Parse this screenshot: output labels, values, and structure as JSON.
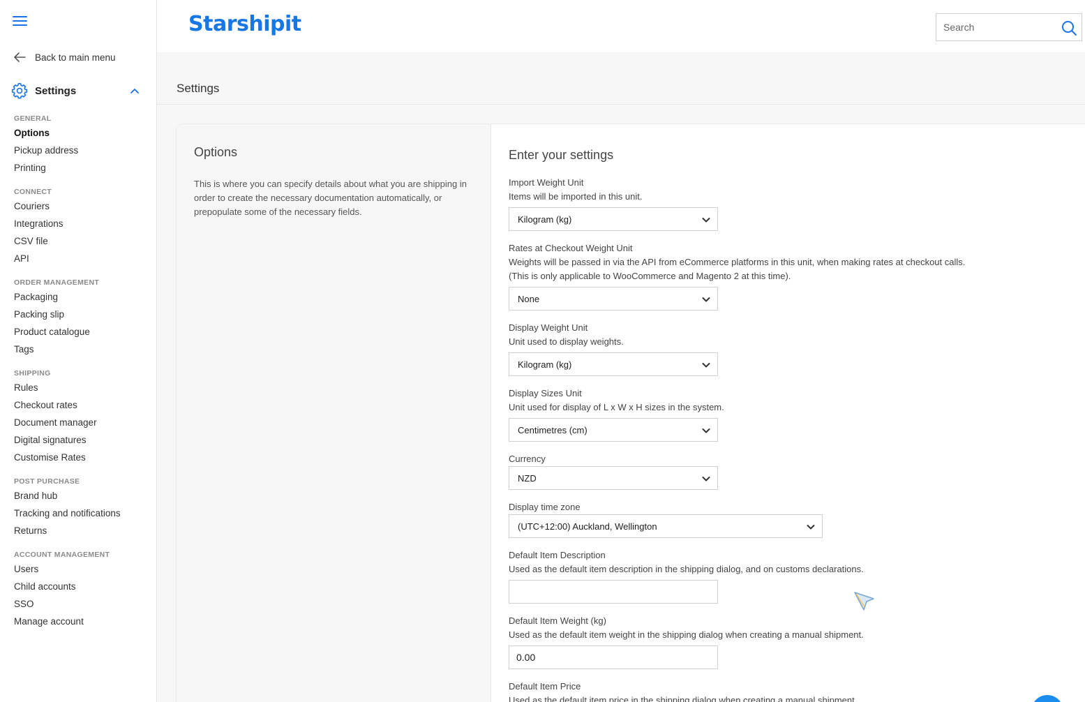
{
  "sidebar": {
    "back_label": "Back to main menu",
    "section_title": "Settings",
    "groups": [
      {
        "title": "GENERAL",
        "items": [
          "Options",
          "Pickup address",
          "Printing"
        ]
      },
      {
        "title": "CONNECT",
        "items": [
          "Couriers",
          "Integrations",
          "CSV file",
          "API"
        ]
      },
      {
        "title": "ORDER MANAGEMENT",
        "items": [
          "Packaging",
          "Packing slip",
          "Product catalogue",
          "Tags"
        ]
      },
      {
        "title": "SHIPPING",
        "items": [
          "Rules",
          "Checkout rates",
          "Document manager",
          "Digital signatures",
          "Customise Rates"
        ]
      },
      {
        "title": "POST PURCHASE",
        "items": [
          "Brand hub",
          "Tracking and notifications",
          "Returns"
        ]
      },
      {
        "title": "ACCOUNT MANAGEMENT",
        "items": [
          "Users",
          "Child accounts",
          "SSO",
          "Manage account"
        ]
      }
    ],
    "active_item": "Options"
  },
  "header": {
    "brand": "Starshipit",
    "search_placeholder": "Search"
  },
  "page": {
    "title": "Settings"
  },
  "card": {
    "left_title": "Options",
    "left_description": "This is where you can specify details about what you are shipping in order to create the necessary documentation automatically, or prepopulate some of the necessary fields.",
    "right_title": "Enter your settings",
    "fields": {
      "import_weight": {
        "label": "Import Weight Unit",
        "help": "Items will be imported in this unit.",
        "value": "Kilogram (kg)"
      },
      "rates_weight": {
        "label": "Rates at Checkout Weight Unit",
        "help1": "Weights will be passed in via the API from eCommerce platforms in this unit, when making rates at checkout calls.",
        "help2": "(This is only applicable to WooCommerce and Magento 2 at this time).",
        "value": "None"
      },
      "display_weight": {
        "label": "Display Weight Unit",
        "help": "Unit used to display weights.",
        "value": "Kilogram (kg)"
      },
      "display_sizes": {
        "label": "Display Sizes Unit",
        "help": "Unit used for display of L x W x H sizes in the system.",
        "value": "Centimetres (cm)"
      },
      "currency": {
        "label": "Currency",
        "value": "NZD"
      },
      "time_zone": {
        "label": "Display time zone",
        "value": "(UTC+12:00) Auckland, Wellington"
      },
      "default_description": {
        "label": "Default Item Description",
        "help": "Used as the default item description in the shipping dialog, and on customs declarations.",
        "value": ""
      },
      "default_weight": {
        "label": "Default Item Weight (kg)",
        "help": "Used as the default item weight in the shipping dialog when creating a manual shipment.",
        "value": "0.00"
      },
      "default_price": {
        "label": "Default Item Price",
        "help": "Used as the default item price in the shipping dialog when creating a manual shipment."
      }
    }
  },
  "colors": {
    "brand_blue": "#1677e5",
    "accent_blue": "#1a73e8",
    "page_bg": "#f7f7f7"
  }
}
